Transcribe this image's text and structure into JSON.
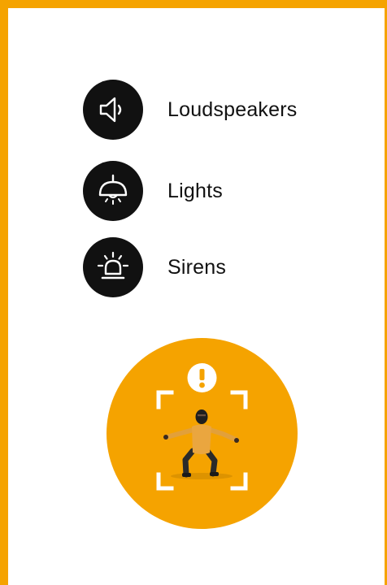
{
  "devices": [
    {
      "label": "Loudspeakers",
      "icon": "loudspeaker-icon"
    },
    {
      "label": "Lights",
      "icon": "ceiling-light-icon"
    },
    {
      "label": "Sirens",
      "icon": "siren-icon"
    }
  ],
  "alert": {
    "icon": "exclamation-icon",
    "frame": "detection-frame-icon",
    "figure": "intruder-figure"
  },
  "colors": {
    "accent": "#f5a300",
    "icon_background": "#111111",
    "text": "#111111"
  }
}
